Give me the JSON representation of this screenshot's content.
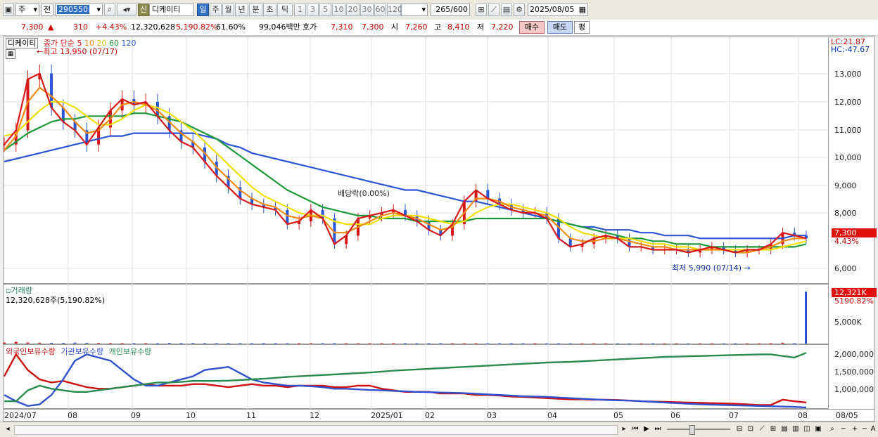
{
  "toolbar": {
    "period_unit": "주",
    "prev_label": "전",
    "code": "290550",
    "new_badge": "신",
    "stock_name": "디케이티",
    "intervals": [
      "일",
      "주",
      "월",
      "년",
      "분",
      "초",
      "틱"
    ],
    "selected_interval": "일",
    "minute_options": [
      "1",
      "3",
      "5",
      "10",
      "20",
      "30",
      "60",
      "120"
    ],
    "view_count": "265",
    "view_max": "/600",
    "date": "2025/08/05"
  },
  "quote": {
    "price": "7,300",
    "change": "310",
    "change_pct": "+4.43%",
    "volume": "12,320,628",
    "volume_pct": "5,190.82%",
    "rotation_pct": "61.60%",
    "amount": "99,046백만",
    "bid_label": "호가",
    "bid": "7,310",
    "ask": "7,300",
    "open_label": "시",
    "open": "7,260",
    "high_label": "고",
    "high": "8,410",
    "low_label": "저",
    "low": "7,220",
    "buy_label": "매수",
    "sell_label": "매도",
    "eval_label": "평"
  },
  "price_panel": {
    "title": "디케이티",
    "ma_label": "종가 단순",
    "ma_periods": [
      "5",
      "10",
      "20",
      "60",
      "120"
    ],
    "ma_colors": [
      "#d81818",
      "#f08a10",
      "#f0e000",
      "#1c9a3a",
      "#2a55d6"
    ],
    "high_annot": "최고 13,950 (07/17)",
    "low_annot": "최저 5,990 (07/14)",
    "dividend_annot": "배당락(0.00%)",
    "lc": "LC:21.87",
    "hc": "HC:-47.67",
    "current_price": "7,300",
    "current_pct": "4.43%",
    "y_ticks": [
      "13,000",
      "12,000",
      "11,000",
      "10,000",
      "9,000",
      "8,000",
      "6,000"
    ]
  },
  "volume_panel": {
    "title": "거래량",
    "info": "12,320,628주(5,190.82%)",
    "current_badge": "12,321K",
    "current_pct": "5190.82%",
    "y_tick": "5,000K"
  },
  "holding_panel": {
    "legend": [
      "외국인보유수량",
      "기관보유수량",
      "개인보유수량"
    ],
    "colors": [
      "#d01010",
      "#3050d0",
      "#2a8a50"
    ],
    "y_ticks": [
      "2,000,000",
      "1,500,000",
      "1,000,000"
    ]
  },
  "x_axis": {
    "labels": [
      "2024/07",
      "08",
      "09",
      "10",
      "11",
      "12",
      "2025/01",
      "02",
      "03",
      "04",
      "05",
      "06",
      "07",
      "08",
      "08/05"
    ]
  },
  "chart_data": {
    "type": "line",
    "price_series": [
      {
        "name": "5",
        "values": [
          10300,
          10800,
          12600,
          12800,
          11600,
          11100,
          10800,
          10300,
          10900,
          11500,
          11900,
          11700,
          11800,
          11300,
          10800,
          10400,
          10200,
          9700,
          9200,
          8800,
          8400,
          8200,
          8100,
          8000,
          7500,
          7600,
          8000,
          7700,
          6800,
          7100,
          7700,
          7800,
          7900,
          8000,
          7800,
          7600,
          7300,
          7100,
          7500,
          8300,
          8700,
          8400,
          8200,
          8000,
          7900,
          7900,
          7700,
          7000,
          6700,
          6800,
          7000,
          7100,
          7000,
          6700,
          6700,
          6600,
          6600,
          6600,
          6500,
          6600,
          6700,
          6600,
          6500,
          6600,
          6600,
          6800,
          7200,
          7100,
          7000
        ]
      },
      {
        "name": "10",
        "values": [
          10100,
          10600,
          11800,
          12300,
          12000,
          11600,
          11100,
          10700,
          10800,
          11200,
          11700,
          11800,
          11700,
          11500,
          11100,
          10700,
          10400,
          10000,
          9500,
          9100,
          8700,
          8400,
          8200,
          8100,
          7800,
          7700,
          7800,
          7700,
          7200,
          7200,
          7400,
          7600,
          7800,
          7900,
          7800,
          7700,
          7500,
          7300,
          7400,
          7900,
          8400,
          8400,
          8300,
          8100,
          8000,
          7900,
          7800,
          7400,
          7000,
          6900,
          6900,
          7000,
          7000,
          6900,
          6800,
          6700,
          6700,
          6600,
          6600,
          6600,
          6600,
          6600,
          6500,
          6500,
          6600,
          6700,
          6900,
          7000,
          7000
        ]
      },
      {
        "name": "20",
        "values": [
          10600,
          10700,
          11100,
          11500,
          11800,
          11800,
          11600,
          11300,
          11000,
          11000,
          11200,
          11500,
          11700,
          11600,
          11400,
          11100,
          10800,
          10400,
          10000,
          9600,
          9200,
          8800,
          8500,
          8300,
          8100,
          7900,
          7800,
          7800,
          7600,
          7500,
          7500,
          7500,
          7700,
          7800,
          7800,
          7800,
          7700,
          7600,
          7500,
          7600,
          7900,
          8100,
          8200,
          8200,
          8100,
          8000,
          7900,
          7700,
          7400,
          7200,
          7100,
          7000,
          7000,
          7000,
          6900,
          6800,
          6800,
          6700,
          6700,
          6600,
          6600,
          6600,
          6600,
          6600,
          6600,
          6600,
          6700,
          6800,
          6900
        ]
      },
      {
        "name": "60",
        "values": [
          10100,
          10400,
          10700,
          10900,
          11100,
          11200,
          11200,
          11300,
          11300,
          11300,
          11300,
          11400,
          11400,
          11300,
          11200,
          11100,
          10900,
          10700,
          10500,
          10200,
          9900,
          9600,
          9300,
          9000,
          8700,
          8500,
          8300,
          8100,
          8000,
          7900,
          7800,
          7800,
          7700,
          7700,
          7700,
          7600,
          7600,
          7600,
          7600,
          7600,
          7700,
          7700,
          7700,
          7700,
          7700,
          7700,
          7700,
          7600,
          7500,
          7400,
          7300,
          7200,
          7100,
          7000,
          7000,
          6900,
          6900,
          6800,
          6800,
          6800,
          6700,
          6700,
          6700,
          6700,
          6700,
          6700,
          6700,
          6700,
          6800
        ]
      },
      {
        "name": "120",
        "values": [
          9700,
          9800,
          9900,
          10000,
          10100,
          10200,
          10300,
          10400,
          10500,
          10600,
          10600,
          10700,
          10700,
          10700,
          10700,
          10700,
          10700,
          10600,
          10500,
          10300,
          10200,
          10000,
          9900,
          9800,
          9700,
          9600,
          9500,
          9400,
          9300,
          9200,
          9100,
          9000,
          8900,
          8800,
          8700,
          8700,
          8600,
          8500,
          8400,
          8300,
          8300,
          8200,
          8100,
          8000,
          7900,
          7800,
          7700,
          7600,
          7500,
          7400,
          7400,
          7300,
          7300,
          7300,
          7200,
          7200,
          7100,
          7100,
          7100,
          7000,
          7000,
          7000,
          7000,
          7000,
          7000,
          7000,
          7000,
          7100,
          7100
        ]
      }
    ],
    "volume_k": [
      250,
      420,
      250,
      200,
      180,
      150,
      220,
      180,
      120,
      110,
      100,
      100,
      90,
      80,
      150,
      100,
      120,
      90,
      80,
      90,
      80,
      70,
      90,
      80,
      70,
      70,
      90,
      80,
      80,
      70,
      60,
      60,
      70,
      70,
      60,
      60,
      90,
      80,
      70,
      60,
      60,
      70,
      80,
      70,
      60,
      50,
      50,
      60,
      50,
      40,
      40,
      30,
      40,
      30,
      30,
      40,
      30,
      30,
      30,
      40,
      40,
      30,
      40,
      30,
      40,
      50,
      200,
      60,
      12321
    ],
    "holdings": [
      {
        "name": "외국인보유수량",
        "values": [
          1300000,
          2000000,
          1500000,
          1200000,
          1100000,
          1150000,
          1050000,
          950000,
          900000,
          900000,
          950000,
          1000000,
          1050000,
          1000000,
          1000000,
          1000000,
          1050000,
          1050000,
          1000000,
          950000,
          1000000,
          1050000,
          1000000,
          1000000,
          950000,
          1000000,
          1000000,
          1000000,
          950000,
          950000,
          1000000,
          1000000,
          900000,
          850000,
          800000,
          800000,
          800000,
          750000,
          750000,
          750000,
          700000,
          700000,
          680000,
          650000,
          640000,
          620000,
          600000,
          580000,
          560000,
          560000,
          550000,
          550000,
          540000,
          520000,
          500000,
          490000,
          480000,
          470000,
          460000,
          450000,
          440000,
          430000,
          420000,
          400000,
          380000,
          380000,
          550000,
          500000,
          460000
        ]
      },
      {
        "name": "기관보유수량",
        "values": [
          700000,
          500000,
          350000,
          400000,
          700000,
          1200000,
          1800000,
          2000000,
          1900000,
          1800000,
          1500000,
          1200000,
          1000000,
          1000000,
          1100000,
          1200000,
          1300000,
          1500000,
          1550000,
          1600000,
          1400000,
          1200000,
          1100000,
          1050000,
          1000000,
          1000000,
          980000,
          950000,
          900000,
          900000,
          880000,
          860000,
          850000,
          830000,
          820000,
          800000,
          790000,
          780000,
          770000,
          760000,
          740000,
          720000,
          700000,
          680000,
          660000,
          650000,
          640000,
          620000,
          600000,
          580000,
          560000,
          540000,
          530000,
          520000,
          500000,
          480000,
          460000,
          440000,
          420000,
          400000,
          390000,
          380000,
          370000,
          360000,
          350000,
          340000,
          330000,
          320000,
          300000
        ]
      },
      {
        "name": "개인보유수량",
        "values": [
          500000,
          500000,
          850000,
          1000000,
          900000,
          850000,
          800000,
          800000,
          850000,
          900000,
          950000,
          1000000,
          1050000,
          1100000,
          1100000,
          1120000,
          1150000,
          1150000,
          1150000,
          1160000,
          1180000,
          1200000,
          1220000,
          1250000,
          1280000,
          1300000,
          1320000,
          1340000,
          1360000,
          1380000,
          1400000,
          1420000,
          1450000,
          1480000,
          1500000,
          1520000,
          1540000,
          1560000,
          1580000,
          1600000,
          1620000,
          1640000,
          1660000,
          1680000,
          1700000,
          1720000,
          1740000,
          1750000,
          1760000,
          1780000,
          1800000,
          1820000,
          1840000,
          1860000,
          1880000,
          1900000,
          1920000,
          1930000,
          1940000,
          1950000,
          1960000,
          1970000,
          1980000,
          1990000,
          2000000,
          2000000,
          1950000,
          1900000,
          2050000
        ]
      }
    ],
    "price_ylim": [
      5500,
      14000
    ],
    "volume_ylim": [
      0,
      12500
    ],
    "holdings_ylim": [
      300000,
      2100000
    ],
    "grid": true
  }
}
